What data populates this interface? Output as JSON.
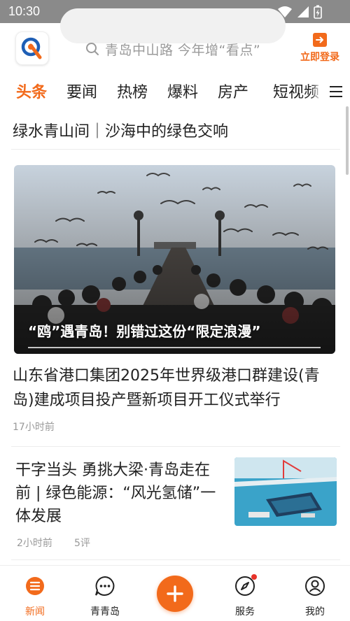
{
  "status_bar": {
    "time": "10:30"
  },
  "header": {
    "search_placeholder": "青岛中山路 今年增“看点”",
    "login_label": "立即登录"
  },
  "tabs": [
    {
      "label": "头条",
      "active": true
    },
    {
      "label": "要闻"
    },
    {
      "label": "热榜"
    },
    {
      "label": "爆料"
    },
    {
      "label": "房产"
    },
    {
      "label": "短视频"
    }
  ],
  "feed": {
    "top_headline": "绿水青山间｜沙海中的绿色交响",
    "hero": {
      "caption": "“鸥”遇青岛！别错过这份“限定浪漫”"
    },
    "article": {
      "title": "山东省港口集团2025年世界级港口群建设(青岛)建成项目投产暨新项目开工仪式举行",
      "time": "17小时前"
    },
    "news_item": {
      "title": "干字当头 勇挑大梁·青岛走在前 | 绿色能源：“风光氢储”一体发展",
      "time": "2小时前",
      "comments": "5评"
    }
  },
  "bottom_nav": [
    {
      "label": "新闻",
      "icon": "news-icon",
      "active": true
    },
    {
      "label": "青青岛",
      "icon": "chat-icon"
    },
    {
      "label": "",
      "icon": "plus-icon"
    },
    {
      "label": "服务",
      "icon": "compass-icon",
      "badge": true
    },
    {
      "label": "我的",
      "icon": "user-icon"
    }
  ],
  "colors": {
    "accent": "#f26a1b",
    "badge": "#e8332a"
  }
}
